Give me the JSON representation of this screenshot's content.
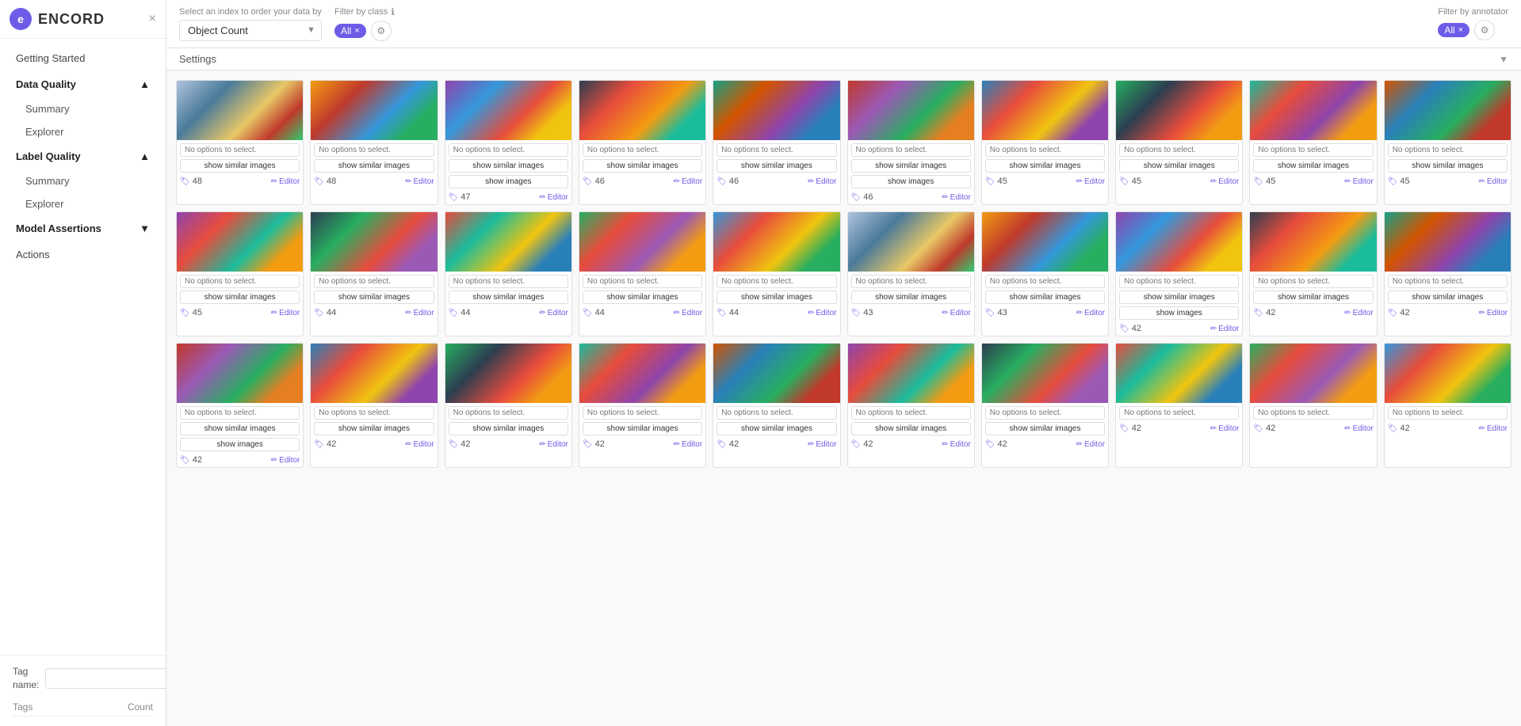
{
  "app": {
    "name": "ENCORD",
    "close_label": "×"
  },
  "sidebar": {
    "getting_started_label": "Getting Started",
    "data_quality_label": "Data Quality",
    "data_quality_expanded": true,
    "label_quality_label": "Label Quality",
    "label_quality_expanded": true,
    "model_assertions_label": "Model Assertions",
    "actions_label": "Actions",
    "summary_label_1": "Summary",
    "explorer_label_1": "Explorer",
    "summary_label_2": "Summary",
    "explorer_label_2": "Explorer",
    "tag_name_label": "Tag\nname:",
    "tag_input_placeholder": "",
    "tag_add_label": "+",
    "tags_col": "Tags",
    "count_col": "Count"
  },
  "toolbar": {
    "order_label": "Select an index to order your data by",
    "order_value": "Object Count",
    "filter_class_label": "Filter by class",
    "filter_class_chip": "All",
    "filter_annotator_label": "Filter by annotator",
    "filter_annotator_chip": "All",
    "settings_label": "Settings",
    "info_icon": "ℹ"
  },
  "grid": {
    "rows": [
      {
        "cards": [
          {
            "img_class": "img-1",
            "options": "No options to select.",
            "show_btn": "show similar images",
            "count": "48",
            "has_show_images": false
          },
          {
            "img_class": "img-2",
            "options": "No options to select.",
            "show_btn": "show similar images",
            "count": "48",
            "has_show_images": false
          },
          {
            "img_class": "img-3",
            "options": "No options to select.",
            "show_btn": "show similar images",
            "count": "47",
            "has_show_images": true,
            "show_images_label": "show images"
          },
          {
            "img_class": "img-4",
            "options": "No options to select.",
            "show_btn": "show similar images",
            "count": "46",
            "has_show_images": false
          },
          {
            "img_class": "img-5",
            "options": "No options to select.",
            "show_btn": "show similar images",
            "count": "46",
            "has_show_images": false
          },
          {
            "img_class": "img-6",
            "options": "No options to select.",
            "show_btn": "show similar images",
            "count": "46",
            "has_show_images": true,
            "show_images_label": "show images"
          },
          {
            "img_class": "img-7",
            "options": "No options to select.",
            "show_btn": "show similar images",
            "count": "45",
            "has_show_images": false
          },
          {
            "img_class": "img-8",
            "options": "No options to select.",
            "show_btn": "show similar images",
            "count": "45",
            "has_show_images": false
          },
          {
            "img_class": "img-9",
            "options": "No options to select.",
            "show_btn": "show similar images",
            "count": "45",
            "has_show_images": false
          },
          {
            "img_class": "img-10",
            "options": "No options to select.",
            "show_btn": "show similar images",
            "count": "45",
            "has_show_images": false
          }
        ]
      },
      {
        "cards": [
          {
            "img_class": "img-11",
            "options": "No options to select.",
            "show_btn": "show similar images",
            "count": "45",
            "has_show_images": false
          },
          {
            "img_class": "img-12",
            "options": "No options to select.",
            "show_btn": "show similar images",
            "count": "44",
            "has_show_images": false
          },
          {
            "img_class": "img-13",
            "options": "No options to select.",
            "show_btn": "show similar images",
            "count": "44",
            "has_show_images": false
          },
          {
            "img_class": "img-14",
            "options": "No options to select.",
            "show_btn": "show similar images",
            "count": "44",
            "has_show_images": false
          },
          {
            "img_class": "img-15",
            "options": "No options to select.",
            "show_btn": "show similar images",
            "count": "44",
            "has_show_images": false
          },
          {
            "img_class": "img-1",
            "options": "No options to select.",
            "show_btn": "show similar images",
            "count": "43",
            "has_show_images": false
          },
          {
            "img_class": "img-2",
            "options": "No options to select.",
            "show_btn": "show similar images",
            "count": "43",
            "has_show_images": false
          },
          {
            "img_class": "img-3",
            "options": "No options to select.",
            "show_btn": "show similar images",
            "count": "42",
            "has_show_images": true,
            "show_images_label": "show images"
          },
          {
            "img_class": "img-4",
            "options": "No options to select.",
            "show_btn": "show similar images",
            "count": "42",
            "has_show_images": false
          },
          {
            "img_class": "img-5",
            "options": "No options to select.",
            "show_btn": "show similar images",
            "count": "42",
            "has_show_images": false
          }
        ]
      },
      {
        "cards": [
          {
            "img_class": "img-6",
            "options": "No options to select.",
            "show_btn": "show similar images",
            "count": "42",
            "has_show_images": true,
            "show_images_label": "show images"
          },
          {
            "img_class": "img-7",
            "options": "No options to select.",
            "show_btn": "show similar images",
            "count": "42",
            "has_show_images": false
          },
          {
            "img_class": "img-8",
            "options": "No options to select.",
            "show_btn": "show similar images",
            "count": "42",
            "has_show_images": false
          },
          {
            "img_class": "img-9",
            "options": "No options to select.",
            "show_btn": "show similar images",
            "count": "42",
            "has_show_images": false
          },
          {
            "img_class": "img-10",
            "options": "No options to select.",
            "show_btn": "show similar images",
            "count": "42",
            "has_show_images": false
          },
          {
            "img_class": "img-11",
            "options": "No options to select.",
            "show_btn": "show similar images",
            "count": "42",
            "has_show_images": false
          },
          {
            "img_class": "img-12",
            "options": "No options to select.",
            "show_btn": "show similar images",
            "count": "42",
            "has_show_images": false
          },
          {
            "img_class": "img-13",
            "options": "No options to select.",
            "show_btn": "",
            "count": "42",
            "has_show_images": false
          },
          {
            "img_class": "img-14",
            "options": "No options to select.",
            "show_btn": "",
            "count": "42",
            "has_show_images": false
          },
          {
            "img_class": "img-15",
            "options": "No options to select.",
            "show_btn": "",
            "count": "42",
            "has_show_images": false
          }
        ]
      }
    ]
  },
  "editor_label": "Editor",
  "no_options_label": "No options to select.",
  "options_label": "options"
}
